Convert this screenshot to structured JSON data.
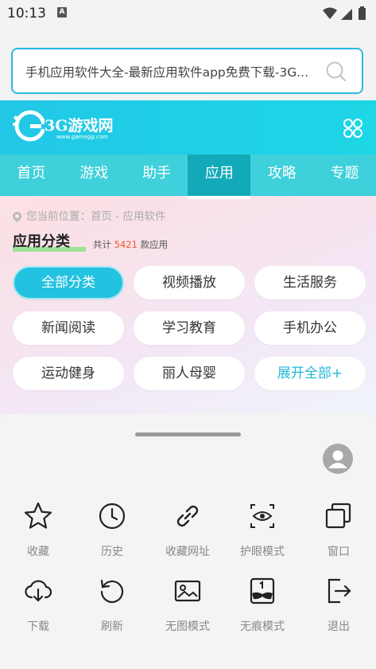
{
  "status_bar": {
    "time": "10:13",
    "notification_icon": "A"
  },
  "address_bar": {
    "url_text": "手机应用软件大全-最新应用软件app免费下载-3G...",
    "search_icon": "search-icon"
  },
  "site": {
    "logo": {
      "name": "3G游戏网",
      "domain": "www.gamegg.com"
    },
    "nav": [
      "首页",
      "游戏",
      "助手",
      "应用",
      "攻略",
      "专题"
    ],
    "nav_active": "应用",
    "location": "您当前位置：首页 - 应用软件",
    "category_title": "应用分类",
    "count_prefix": "共计",
    "count_value": "5421",
    "count_suffix": "款应用",
    "categories": [
      "全部分类",
      "视频播放",
      "生活服务",
      "新闻阅读",
      "学习教育",
      "手机办公",
      "运动健身",
      "丽人母婴",
      "展开全部+"
    ]
  },
  "sheet": {
    "actions": [
      {
        "label": "收藏",
        "icon": "star-icon"
      },
      {
        "label": "历史",
        "icon": "clock-icon"
      },
      {
        "label": "收藏网址",
        "icon": "link-icon"
      },
      {
        "label": "护眼模式",
        "icon": "eye-icon"
      },
      {
        "label": "窗口",
        "icon": "windows-icon"
      },
      {
        "label": "下载",
        "icon": "cloud-download-icon"
      },
      {
        "label": "刷新",
        "icon": "refresh-icon"
      },
      {
        "label": "无图模式",
        "icon": "no-image-icon"
      },
      {
        "label": "无痕模式",
        "icon": "incognito-icon"
      },
      {
        "label": "退出",
        "icon": "exit-icon"
      }
    ]
  },
  "colors": {
    "accent": "#22c7e6",
    "nav_active": "#12aab8",
    "count": "#f05a28",
    "chip_active": "#23c2e0"
  }
}
